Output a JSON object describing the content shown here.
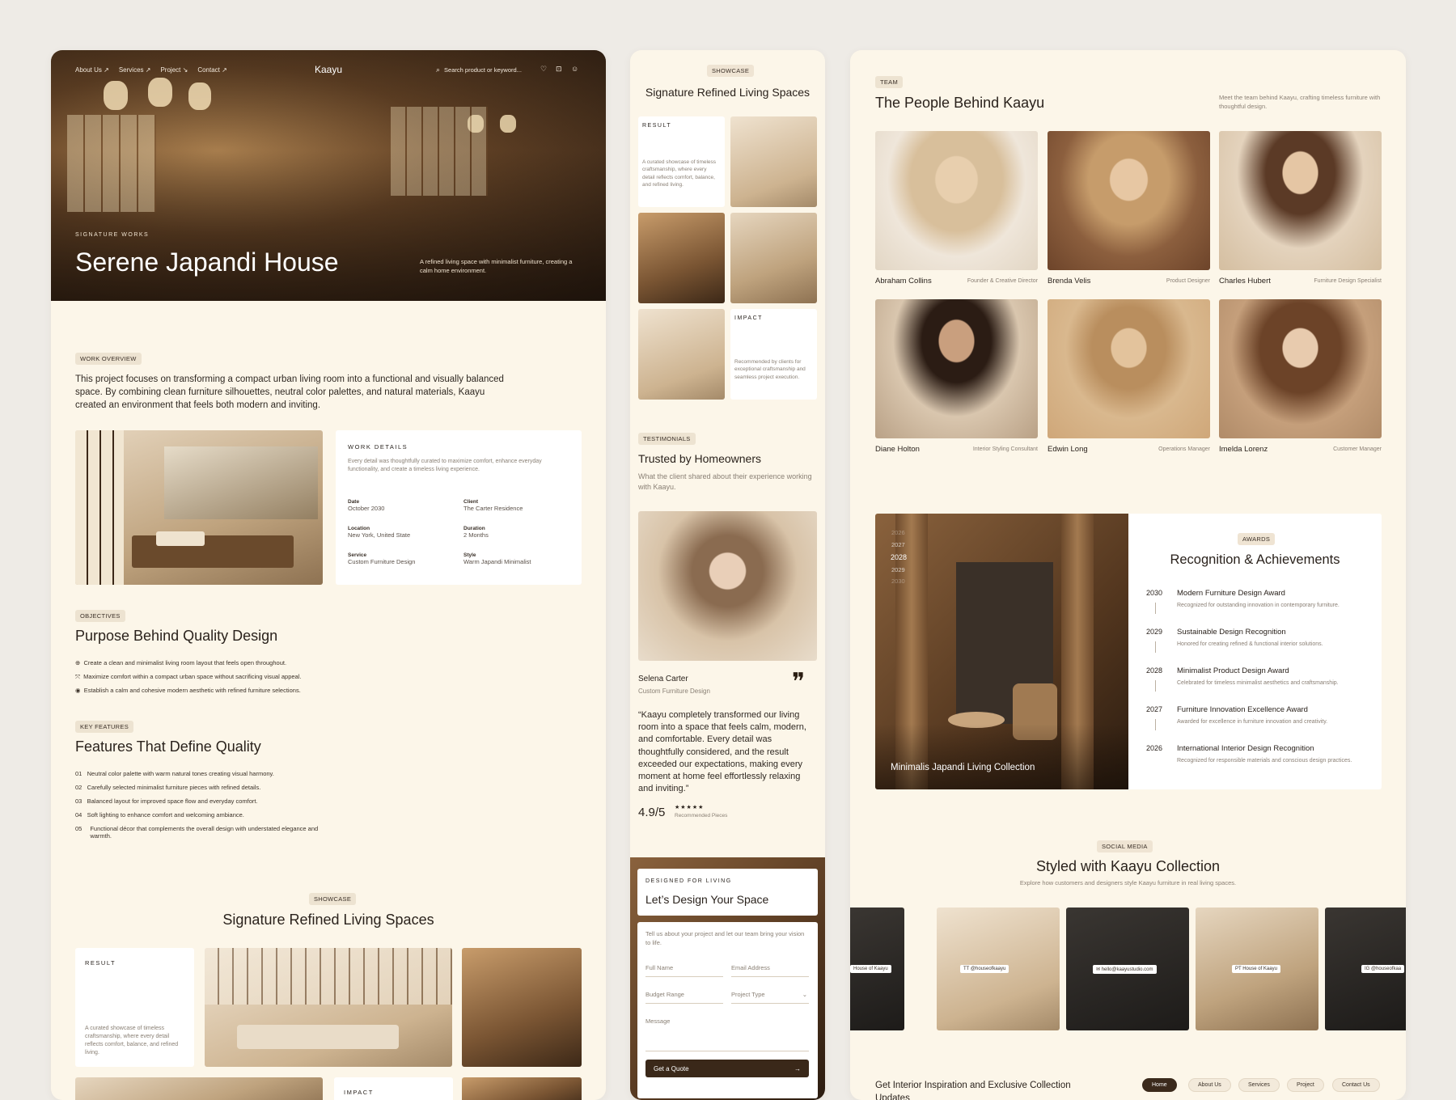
{
  "brand": "Kaayu",
  "nav": {
    "items": [
      "About Us",
      "Services",
      "Project",
      "Contact"
    ],
    "search_placeholder": "Search product or keyword..."
  },
  "hero": {
    "eyebrow": "SIGNATURE WORKS",
    "title": "Serene Japandi House",
    "caption": "A refined living space with minimalist furniture, creating a calm home environment."
  },
  "overview": {
    "tag": "WORK OVERVIEW",
    "text": "This project focuses on transforming a compact urban living room into a functional and visually balanced space. By combining clean furniture silhouettes, neutral color palettes, and natural materials, Kaayu created an environment that feels both modern and inviting."
  },
  "work_details": {
    "title": "WORK DETAILS",
    "desc": "Every detail was thoughtfully curated to maximize comfort, enhance everyday functionality, and create a timeless living experience.",
    "items": [
      {
        "label": "Date",
        "value": "October 2030"
      },
      {
        "label": "Client",
        "value": "The Carter Residence"
      },
      {
        "label": "Location",
        "value": "New York, United State"
      },
      {
        "label": "Duration",
        "value": "2 Months"
      },
      {
        "label": "Service",
        "value": "Custom Furniture Design"
      },
      {
        "label": "Style",
        "value": "Warm Japandi Minimalist"
      }
    ]
  },
  "objectives": {
    "tag": "OBJECTIVES",
    "title": "Purpose Behind Quality Design",
    "items": [
      "Create a clean and minimalist living room layout that feels open throughout.",
      "Maximize comfort within a compact urban space without sacrificing visual appeal.",
      "Establish a calm and cohesive modern aesthetic with refined furniture selections."
    ]
  },
  "features": {
    "tag": "KEY FEATURES",
    "title": "Features That Define Quality",
    "items": [
      {
        "num": "01",
        "text": "Neutral color palette with warm natural tones creating visual harmony."
      },
      {
        "num": "02",
        "text": "Carefully selected minimalist furniture pieces with refined details."
      },
      {
        "num": "03",
        "text": "Balanced layout for improved space flow and everyday comfort."
      },
      {
        "num": "04",
        "text": "Soft lighting to enhance comfort and welcoming ambiance."
      },
      {
        "num": "05",
        "text": "Functional décor that complements the overall design with understated elegance and warmth."
      }
    ]
  },
  "showcase": {
    "tag": "SHOWCASE",
    "title": "Signature Refined Living Spaces",
    "result_label": "RESULT",
    "result_text": "A curated showcase of timeless craftsmanship, where every detail reflects comfort, balance, and refined living.",
    "impact_label": "IMPACT",
    "impact_text": "Recommended by clients for exceptional craftsmanship and seamless project execution."
  },
  "testimonials": {
    "tag": "TESTIMONIALS",
    "title": "Trusted by Homeowners",
    "subtitle": "What the client shared about their experience working with Kaayu.",
    "name": "Selena Carter",
    "role": "Custom Furniture Design",
    "quote": "“Kaayu completely transformed our living room into a space that feels calm, modern, and comfortable. Every detail was thoughtfully considered, and the result exceeded our expectations, making every moment at home feel effortlessly relaxing and inviting.”",
    "rating": "4.9/5",
    "stars": "★★★★★",
    "rating_caption": "Recommended Pieces"
  },
  "contact": {
    "eyebrow": "DESIGNED FOR LIVING",
    "title": "Let’s Design Your Space",
    "intro": "Tell us about your project and let our team bring your vision to life.",
    "full_name": "Full Name",
    "email": "Email Address",
    "budget": "Budget Range",
    "project_type": "Project Type",
    "message": "Message",
    "cta": "Get a Quote"
  },
  "team": {
    "tag": "TEAM",
    "title": "The People Behind Kaayu",
    "desc": "Meet the team behind Kaayu, crafting timeless furniture with thoughtful design.",
    "members": [
      {
        "name": "Abraham Collins",
        "role": "Founder & Creative Director"
      },
      {
        "name": "Brenda Velis",
        "role": "Product Designer"
      },
      {
        "name": "Charles Hubert",
        "role": "Furniture Design Specialist"
      },
      {
        "name": "Diane Holton",
        "role": "Interior Styling Consultant"
      },
      {
        "name": "Edwin Long",
        "role": "Operations Manager"
      },
      {
        "name": "Imelda Lorenz",
        "role": "Customer Manager"
      }
    ]
  },
  "awards": {
    "tag": "AWARDS",
    "title": "Recognition & Achievements",
    "image_caption": "Minimalis Japandi Living Collection",
    "timeline": [
      "2026",
      "2027",
      "2028",
      "2029",
      "2030"
    ],
    "items": [
      {
        "year": "2030",
        "title": "Modern Furniture Design Award",
        "desc": "Recognized for outstanding innovation in contemporary furniture."
      },
      {
        "year": "2029",
        "title": "Sustainable Design Recognition",
        "desc": "Honored for creating refined & functional interior solutions."
      },
      {
        "year": "2028",
        "title": "Minimalist Product Design Award",
        "desc": "Celebrated for timeless minimalist aesthetics and craftsmanship."
      },
      {
        "year": "2027",
        "title": "Furniture Innovation Excellence Award",
        "desc": "Awarded for excellence in furniture innovation and creativity."
      },
      {
        "year": "2026",
        "title": "International Interior Design Recognition",
        "desc": "Recognized for responsible materials and conscious design practices."
      }
    ]
  },
  "social": {
    "tag": "SOCIAL MEDIA",
    "title": "Styled with Kaayu Collection",
    "subtitle": "Explore how customers and designers style Kaayu furniture in real living spaces.",
    "handles": [
      "House of Kaayu",
      "TT @houseofkaayu",
      "✉ hello@kaayustudio.com",
      "PT House of Kaayu",
      "IG @houseofkaa"
    ]
  },
  "footer": {
    "newsletter": "Get Interior Inspiration and Exclusive Collection Updates",
    "nav": [
      "Home",
      "About Us",
      "Services",
      "Project",
      "Contact Us"
    ]
  }
}
